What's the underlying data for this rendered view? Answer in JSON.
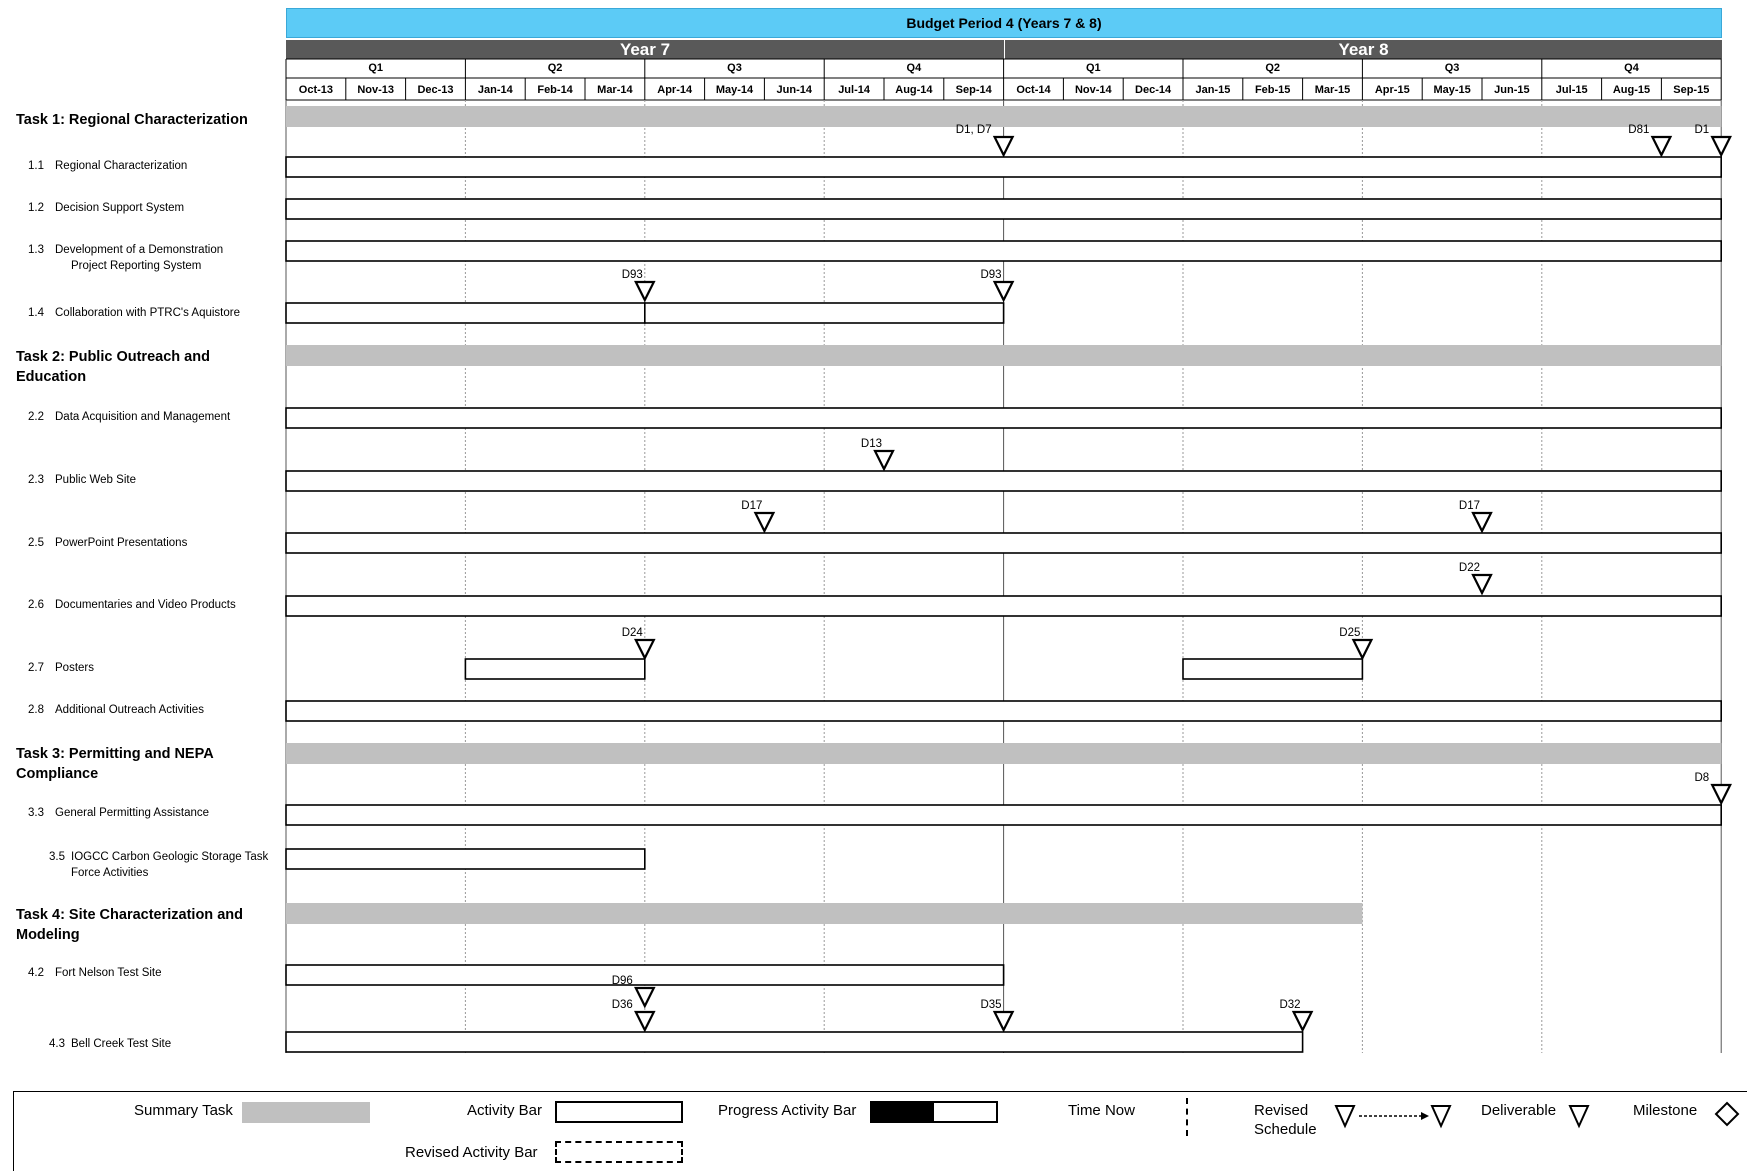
{
  "budget_period_title": "Budget Period 4 (Years 7 & 8)",
  "years": [
    "Year 7",
    "Year 8"
  ],
  "quarters": [
    "Q1",
    "Q2",
    "Q3",
    "Q4",
    "Q1",
    "Q2",
    "Q3",
    "Q4"
  ],
  "months": [
    "Oct-13",
    "Nov-13",
    "Dec-13",
    "Jan-14",
    "Feb-14",
    "Mar-14",
    "Apr-14",
    "May-14",
    "Jun-14",
    "Jul-14",
    "Aug-14",
    "Sep-14",
    "Oct-14",
    "Nov-14",
    "Dec-14",
    "Jan-15",
    "Feb-15",
    "Mar-15",
    "Apr-15",
    "May-15",
    "Jun-15",
    "Jul-15",
    "Aug-15",
    "Sep-15"
  ],
  "tasks": [
    {
      "label": "Task 1: Regional Characterization"
    },
    {
      "label": "Task 2: Public Outreach and Education"
    },
    {
      "label": "Task 3: Permitting and NEPA Compliance"
    },
    {
      "label": "Task 4: Site Characterization and Modeling"
    }
  ],
  "subtasks": [
    {
      "num": "1.1",
      "label": "Regional Characterization"
    },
    {
      "num": "1.2",
      "label": "Decision Support System"
    },
    {
      "num": "1.3",
      "label": "Development of a Demonstration",
      "label2": "Project Reporting System"
    },
    {
      "num": "1.4",
      "label": "Collaboration with PTRC's Aquistore"
    },
    {
      "num": "2.2",
      "label": "Data Acquisition and Management"
    },
    {
      "num": "2.3",
      "label": "Public Web Site"
    },
    {
      "num": "2.5",
      "label": "PowerPoint Presentations"
    },
    {
      "num": "2.6",
      "label": "Documentaries and Video Products"
    },
    {
      "num": "2.7",
      "label": "Posters"
    },
    {
      "num": "2.8",
      "label": "Additional Outreach Activities"
    },
    {
      "num": "3.3",
      "label": "General Permitting Assistance"
    },
    {
      "num": "3.5",
      "label": "IOGCC Carbon Geologic Storage Task",
      "label2": "Force Activities"
    },
    {
      "num": "4.2",
      "label": "Fort Nelson Test Site"
    },
    {
      "num": "4.3",
      "label": "Bell Creek Test Site"
    }
  ],
  "chart_data": {
    "type": "gantt",
    "title": "Budget Period 4 (Years 7 & 8)",
    "time_unit": "month",
    "start_month": "Oct-13",
    "end_month": "Sep-15",
    "summary_tasks": [
      {
        "task": "Task 1: Regional Characterization",
        "start": "Oct-13",
        "end": "Sep-15"
      },
      {
        "task": "Task 2: Public Outreach and Education",
        "start": "Oct-13",
        "end": "Sep-15"
      },
      {
        "task": "Task 3: Permitting and NEPA Compliance",
        "start": "Oct-13",
        "end": "Sep-15"
      },
      {
        "task": "Task 4: Site Characterization and Modeling",
        "start": "Oct-13",
        "end": "Mar-15"
      }
    ],
    "activity_bars": [
      {
        "subtask": "1.1",
        "segments": [
          [
            "Oct-13",
            "Sep-15"
          ]
        ]
      },
      {
        "subtask": "1.2",
        "segments": [
          [
            "Oct-13",
            "Sep-15"
          ]
        ]
      },
      {
        "subtask": "1.3",
        "segments": [
          [
            "Oct-13",
            "Sep-15"
          ]
        ]
      },
      {
        "subtask": "1.4",
        "segments": [
          [
            "Oct-13",
            "Mar-14"
          ],
          [
            "Apr-14",
            "Sep-14"
          ]
        ]
      },
      {
        "subtask": "2.2",
        "segments": [
          [
            "Oct-13",
            "Sep-15"
          ]
        ]
      },
      {
        "subtask": "2.3",
        "segments": [
          [
            "Oct-13",
            "Sep-15"
          ]
        ]
      },
      {
        "subtask": "2.5",
        "segments": [
          [
            "Oct-13",
            "Sep-15"
          ]
        ]
      },
      {
        "subtask": "2.6",
        "segments": [
          [
            "Oct-13",
            "Sep-15"
          ]
        ]
      },
      {
        "subtask": "2.7",
        "segments": [
          [
            "Jan-14",
            "Mar-14"
          ],
          [
            "Jan-15",
            "Mar-15"
          ]
        ]
      },
      {
        "subtask": "2.8",
        "segments": [
          [
            "Oct-13",
            "Sep-15"
          ]
        ]
      },
      {
        "subtask": "3.3",
        "segments": [
          [
            "Oct-13",
            "Sep-15"
          ]
        ]
      },
      {
        "subtask": "3.5",
        "segments": [
          [
            "Oct-13",
            "Mar-14"
          ]
        ]
      },
      {
        "subtask": "4.2",
        "segments": [
          [
            "Oct-13",
            "Sep-14"
          ]
        ]
      },
      {
        "subtask": "4.3",
        "segments": [
          [
            "Oct-13",
            "Feb-15"
          ]
        ]
      }
    ],
    "deliverables": [
      {
        "subtask": "1.1",
        "label": "D1, D7",
        "date": "Sep-14"
      },
      {
        "subtask": "1.1",
        "label": "D81",
        "date": "Aug-15"
      },
      {
        "subtask": "1.1",
        "label": "D1",
        "date": "Sep-15"
      },
      {
        "subtask": "1.4",
        "label": "D93",
        "date": "Mar-14"
      },
      {
        "subtask": "1.4",
        "label": "D93",
        "date": "Sep-14"
      },
      {
        "subtask": "2.3",
        "label": "D13",
        "date": "Jul-14"
      },
      {
        "subtask": "2.5",
        "label": "D17",
        "date": "May-14"
      },
      {
        "subtask": "2.5",
        "label": "D17",
        "date": "May-15"
      },
      {
        "subtask": "2.6",
        "label": "D22",
        "date": "May-15"
      },
      {
        "subtask": "2.7",
        "label": "D24",
        "date": "Mar-14"
      },
      {
        "subtask": "2.7",
        "label": "D25",
        "date": "Mar-15"
      },
      {
        "subtask": "3.3",
        "label": "D8",
        "date": "Sep-15"
      },
      {
        "subtask": "4.3",
        "label": "D96",
        "date": "Mar-14"
      },
      {
        "subtask": "4.3",
        "label": "D36",
        "date": "Mar-14"
      },
      {
        "subtask": "4.3",
        "label": "D35",
        "date": "Sep-14"
      },
      {
        "subtask": "4.3",
        "label": "D32",
        "date": "Feb-15"
      }
    ]
  },
  "legend": {
    "summary_task": "Summary Task",
    "activity_bar": "Activity Bar",
    "progress_activity_bar": "Progress Activity Bar",
    "time_now": "Time Now",
    "revised_schedule_1": "Revised",
    "revised_schedule_2": "Schedule",
    "deliverable": "Deliverable",
    "milestone": "Milestone",
    "revised_activity_bar": "Revised Activity Bar",
    "colors": {
      "summary": "#c0c0c0",
      "header": "#5ccbf6",
      "year_band": "#595959",
      "progress_fill": "#000000"
    }
  }
}
